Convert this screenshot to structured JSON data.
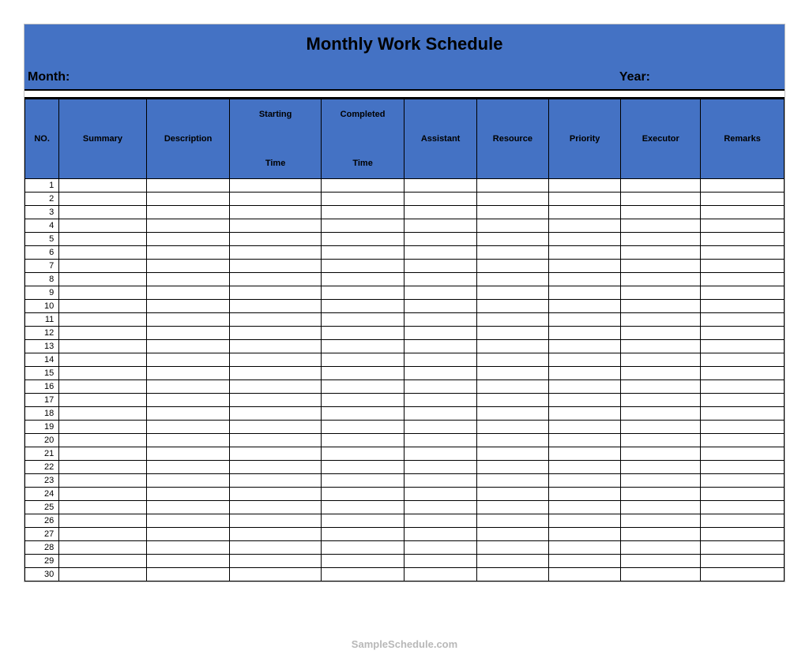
{
  "header": {
    "title": "Monthly Work Schedule",
    "month_label": "Month:",
    "year_label": "Year:"
  },
  "columns": {
    "no": "NO.",
    "summary": "Summary",
    "description": "Description",
    "starting_time": "Starting\n\nTime",
    "completed_time": "Completed\n\nTime",
    "assistant": "Assistant",
    "resource": "Resource",
    "priority": "Priority",
    "executor": "Executor",
    "remarks": "Remarks"
  },
  "rows": [
    {
      "no": "1",
      "summary": "",
      "description": "",
      "starting_time": "",
      "completed_time": "",
      "assistant": "",
      "resource": "",
      "priority": "",
      "executor": "",
      "remarks": ""
    },
    {
      "no": "2",
      "summary": "",
      "description": "",
      "starting_time": "",
      "completed_time": "",
      "assistant": "",
      "resource": "",
      "priority": "",
      "executor": "",
      "remarks": ""
    },
    {
      "no": "3",
      "summary": "",
      "description": "",
      "starting_time": "",
      "completed_time": "",
      "assistant": "",
      "resource": "",
      "priority": "",
      "executor": "",
      "remarks": ""
    },
    {
      "no": "4",
      "summary": "",
      "description": "",
      "starting_time": "",
      "completed_time": "",
      "assistant": "",
      "resource": "",
      "priority": "",
      "executor": "",
      "remarks": ""
    },
    {
      "no": "5",
      "summary": "",
      "description": "",
      "starting_time": "",
      "completed_time": "",
      "assistant": "",
      "resource": "",
      "priority": "",
      "executor": "",
      "remarks": ""
    },
    {
      "no": "6",
      "summary": "",
      "description": "",
      "starting_time": "",
      "completed_time": "",
      "assistant": "",
      "resource": "",
      "priority": "",
      "executor": "",
      "remarks": ""
    },
    {
      "no": "7",
      "summary": "",
      "description": "",
      "starting_time": "",
      "completed_time": "",
      "assistant": "",
      "resource": "",
      "priority": "",
      "executor": "",
      "remarks": ""
    },
    {
      "no": "8",
      "summary": "",
      "description": "",
      "starting_time": "",
      "completed_time": "",
      "assistant": "",
      "resource": "",
      "priority": "",
      "executor": "",
      "remarks": ""
    },
    {
      "no": "9",
      "summary": "",
      "description": "",
      "starting_time": "",
      "completed_time": "",
      "assistant": "",
      "resource": "",
      "priority": "",
      "executor": "",
      "remarks": ""
    },
    {
      "no": "10",
      "summary": "",
      "description": "",
      "starting_time": "",
      "completed_time": "",
      "assistant": "",
      "resource": "",
      "priority": "",
      "executor": "",
      "remarks": ""
    },
    {
      "no": "11",
      "summary": "",
      "description": "",
      "starting_time": "",
      "completed_time": "",
      "assistant": "",
      "resource": "",
      "priority": "",
      "executor": "",
      "remarks": ""
    },
    {
      "no": "12",
      "summary": "",
      "description": "",
      "starting_time": "",
      "completed_time": "",
      "assistant": "",
      "resource": "",
      "priority": "",
      "executor": "",
      "remarks": ""
    },
    {
      "no": "13",
      "summary": "",
      "description": "",
      "starting_time": "",
      "completed_time": "",
      "assistant": "",
      "resource": "",
      "priority": "",
      "executor": "",
      "remarks": ""
    },
    {
      "no": "14",
      "summary": "",
      "description": "",
      "starting_time": "",
      "completed_time": "",
      "assistant": "",
      "resource": "",
      "priority": "",
      "executor": "",
      "remarks": ""
    },
    {
      "no": "15",
      "summary": "",
      "description": "",
      "starting_time": "",
      "completed_time": "",
      "assistant": "",
      "resource": "",
      "priority": "",
      "executor": "",
      "remarks": ""
    },
    {
      "no": "16",
      "summary": "",
      "description": "",
      "starting_time": "",
      "completed_time": "",
      "assistant": "",
      "resource": "",
      "priority": "",
      "executor": "",
      "remarks": ""
    },
    {
      "no": "17",
      "summary": "",
      "description": "",
      "starting_time": "",
      "completed_time": "",
      "assistant": "",
      "resource": "",
      "priority": "",
      "executor": "",
      "remarks": ""
    },
    {
      "no": "18",
      "summary": "",
      "description": "",
      "starting_time": "",
      "completed_time": "",
      "assistant": "",
      "resource": "",
      "priority": "",
      "executor": "",
      "remarks": ""
    },
    {
      "no": "19",
      "summary": "",
      "description": "",
      "starting_time": "",
      "completed_time": "",
      "assistant": "",
      "resource": "",
      "priority": "",
      "executor": "",
      "remarks": ""
    },
    {
      "no": "20",
      "summary": "",
      "description": "",
      "starting_time": "",
      "completed_time": "",
      "assistant": "",
      "resource": "",
      "priority": "",
      "executor": "",
      "remarks": ""
    },
    {
      "no": "21",
      "summary": "",
      "description": "",
      "starting_time": "",
      "completed_time": "",
      "assistant": "",
      "resource": "",
      "priority": "",
      "executor": "",
      "remarks": ""
    },
    {
      "no": "22",
      "summary": "",
      "description": "",
      "starting_time": "",
      "completed_time": "",
      "assistant": "",
      "resource": "",
      "priority": "",
      "executor": "",
      "remarks": ""
    },
    {
      "no": "23",
      "summary": "",
      "description": "",
      "starting_time": "",
      "completed_time": "",
      "assistant": "",
      "resource": "",
      "priority": "",
      "executor": "",
      "remarks": ""
    },
    {
      "no": "24",
      "summary": "",
      "description": "",
      "starting_time": "",
      "completed_time": "",
      "assistant": "",
      "resource": "",
      "priority": "",
      "executor": "",
      "remarks": ""
    },
    {
      "no": "25",
      "summary": "",
      "description": "",
      "starting_time": "",
      "completed_time": "",
      "assistant": "",
      "resource": "",
      "priority": "",
      "executor": "",
      "remarks": ""
    },
    {
      "no": "26",
      "summary": "",
      "description": "",
      "starting_time": "",
      "completed_time": "",
      "assistant": "",
      "resource": "",
      "priority": "",
      "executor": "",
      "remarks": ""
    },
    {
      "no": "27",
      "summary": "",
      "description": "",
      "starting_time": "",
      "completed_time": "",
      "assistant": "",
      "resource": "",
      "priority": "",
      "executor": "",
      "remarks": ""
    },
    {
      "no": "28",
      "summary": "",
      "description": "",
      "starting_time": "",
      "completed_time": "",
      "assistant": "",
      "resource": "",
      "priority": "",
      "executor": "",
      "remarks": ""
    },
    {
      "no": "29",
      "summary": "",
      "description": "",
      "starting_time": "",
      "completed_time": "",
      "assistant": "",
      "resource": "",
      "priority": "",
      "executor": "",
      "remarks": ""
    },
    {
      "no": "30",
      "summary": "",
      "description": "",
      "starting_time": "",
      "completed_time": "",
      "assistant": "",
      "resource": "",
      "priority": "",
      "executor": "",
      "remarks": ""
    }
  ],
  "watermark": "SampleSchedule.com"
}
